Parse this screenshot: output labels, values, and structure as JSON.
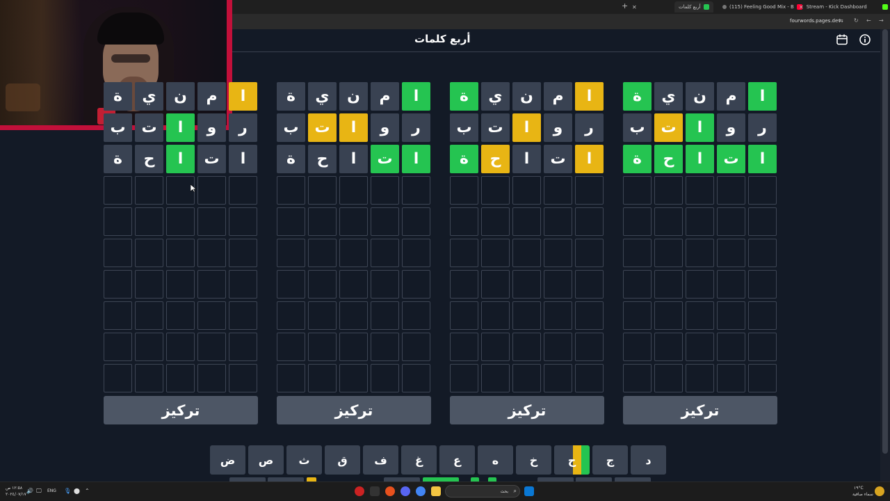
{
  "browser": {
    "tabs": [
      {
        "label": "Stream - Kick Dashboard",
        "color": "#53fc18"
      },
      {
        "label": "(115) Feeling Good Mix - B",
        "color": "#ff0033"
      },
      {
        "label": "أربع كلمات",
        "color": "#25c451"
      }
    ],
    "new_tab_label": "+",
    "url": "fourwords.pages.dev"
  },
  "app": {
    "title": "أربع كلمات",
    "calendar_icon": "calendar-icon",
    "info_icon": "info-icon",
    "focus_label": "تركيز"
  },
  "boards": [
    {
      "rows": [
        [
          [
            "ة",
            "filled"
          ],
          [
            "ي",
            "filled"
          ],
          [
            "ن",
            "filled"
          ],
          [
            "م",
            "filled"
          ],
          [
            "ا",
            "yellow"
          ]
        ],
        [
          [
            "ب",
            "filled"
          ],
          [
            "ت",
            "filled"
          ],
          [
            "ا",
            "green"
          ],
          [
            "و",
            "filled"
          ],
          [
            "ر",
            "filled"
          ]
        ],
        [
          [
            "ة",
            "filled"
          ],
          [
            "ح",
            "filled"
          ],
          [
            "ا",
            "green"
          ],
          [
            "ت",
            "filled"
          ],
          [
            "ا",
            "filled"
          ]
        ]
      ]
    },
    {
      "rows": [
        [
          [
            "ة",
            "filled"
          ],
          [
            "ي",
            "filled"
          ],
          [
            "ن",
            "filled"
          ],
          [
            "م",
            "filled"
          ],
          [
            "ا",
            "green"
          ]
        ],
        [
          [
            "ب",
            "filled"
          ],
          [
            "ت",
            "yellow"
          ],
          [
            "ا",
            "yellow"
          ],
          [
            "و",
            "filled"
          ],
          [
            "ر",
            "filled"
          ]
        ],
        [
          [
            "ة",
            "filled"
          ],
          [
            "ح",
            "filled"
          ],
          [
            "ا",
            "filled"
          ],
          [
            "ت",
            "green"
          ],
          [
            "ا",
            "green"
          ]
        ]
      ]
    },
    {
      "rows": [
        [
          [
            "ة",
            "green"
          ],
          [
            "ي",
            "filled"
          ],
          [
            "ن",
            "filled"
          ],
          [
            "م",
            "filled"
          ],
          [
            "ا",
            "yellow"
          ]
        ],
        [
          [
            "ب",
            "filled"
          ],
          [
            "ت",
            "filled"
          ],
          [
            "ا",
            "yellow"
          ],
          [
            "و",
            "filled"
          ],
          [
            "ر",
            "filled"
          ]
        ],
        [
          [
            "ة",
            "green"
          ],
          [
            "ح",
            "yellow"
          ],
          [
            "ا",
            "filled"
          ],
          [
            "ت",
            "filled"
          ],
          [
            "ا",
            "yellow"
          ]
        ]
      ]
    },
    {
      "rows": [
        [
          [
            "ة",
            "green"
          ],
          [
            "ي",
            "filled"
          ],
          [
            "ن",
            "filled"
          ],
          [
            "م",
            "filled"
          ],
          [
            "ا",
            "green"
          ]
        ],
        [
          [
            "ب",
            "filled"
          ],
          [
            "ت",
            "yellow"
          ],
          [
            "ا",
            "green"
          ],
          [
            "و",
            "filled"
          ],
          [
            "ر",
            "filled"
          ]
        ],
        [
          [
            "ة",
            "green"
          ],
          [
            "ح",
            "green"
          ],
          [
            "ا",
            "green"
          ],
          [
            "ت",
            "green"
          ],
          [
            "ا",
            "green"
          ]
        ]
      ]
    }
  ],
  "keyboard": {
    "row1": [
      "ض",
      "ص",
      "ث",
      "ق",
      "ف",
      "غ",
      "ع",
      "ه",
      "خ",
      "ح",
      "ج",
      "د"
    ]
  },
  "taskbar": {
    "search_placeholder": "بحث",
    "language": "ENG",
    "time": "١٢:٥٨ ص",
    "date": "٢٠٢٤/٠٧/١٧",
    "weather_temp": "١٩°C",
    "weather_desc": "سماء صافية"
  },
  "colors": {
    "green": "#25c451",
    "yellow": "#e8b514",
    "tile_filled": "#394252",
    "background": "#131a26"
  }
}
